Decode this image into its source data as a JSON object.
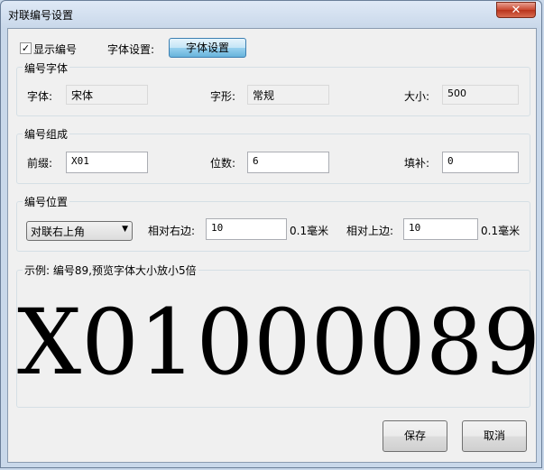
{
  "window": {
    "title": "对联编号设置",
    "close_glyph": "✕"
  },
  "show_number": {
    "label": "显示编号",
    "checked": true,
    "check_glyph": "✓"
  },
  "font_setting": {
    "label": "字体设置:",
    "button_label": "字体设置"
  },
  "number_font": {
    "group_title": "编号字体",
    "font_label": "字体:",
    "font_value": "宋体",
    "style_label": "字形:",
    "style_value": "常规",
    "size_label": "大小:",
    "size_value": "500"
  },
  "number_compose": {
    "group_title": "编号组成",
    "prefix_label": "前缀:",
    "prefix_value": "X01",
    "digits_label": "位数:",
    "digits_value": "6",
    "pad_label": "填补:",
    "pad_value": "0"
  },
  "number_position": {
    "group_title": "编号位置",
    "corner_value": "对联右上角",
    "dropdown_glyph": "▼",
    "right_label": "相对右边:",
    "right_value": "10",
    "right_unit": "0.1毫米",
    "top_label": "相对上边:",
    "top_value": "10",
    "top_unit": "0.1毫米"
  },
  "example": {
    "caption": "示例: 编号89,预览字体大小放小5倍",
    "preview_text": "X01000089"
  },
  "buttons": {
    "save": "保存",
    "cancel": "取消"
  }
}
